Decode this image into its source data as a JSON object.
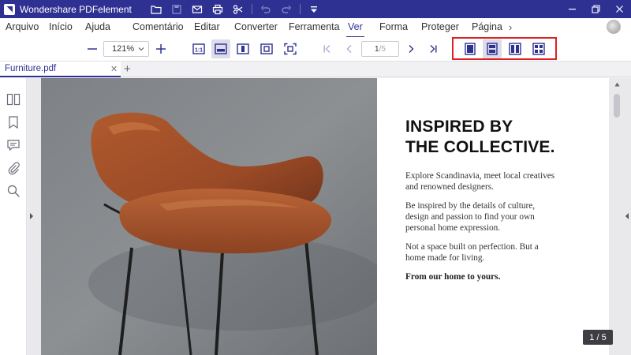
{
  "app": {
    "title": "Wondershare PDFelement"
  },
  "menu": {
    "items": [
      {
        "label": "Arquivo"
      },
      {
        "label": "Início"
      },
      {
        "label": "Ajuda"
      },
      {
        "label": "Comentário"
      },
      {
        "label": "Editar"
      },
      {
        "label": "Converter"
      },
      {
        "label": "Ferramenta"
      },
      {
        "label": "Ver",
        "active": true
      },
      {
        "label": "Forma"
      },
      {
        "label": "Proteger"
      },
      {
        "label": "Página"
      }
    ],
    "more_icon": "chevron-right-icon"
  },
  "toolbar": {
    "zoom_value": "121%",
    "page_current": "1",
    "page_total": "/5",
    "highlighted_group": [
      "single-page-view",
      "single-page-scroll-view",
      "two-page-view",
      "two-page-scroll-view"
    ]
  },
  "tabs": [
    {
      "label": "Furniture.pdf"
    }
  ],
  "document": {
    "headline_line1": "INSPIRED BY",
    "headline_line2": "THE COLLECTIVE.",
    "para1": "Explore Scandinavia, meet local creatives\nand renowned designers.",
    "para2": "Be inspired by the details of culture,\ndesign and passion to find your own\npersonal home expression.",
    "para3": "Not a space built on perfection. But a\nhome made for living.",
    "para4": "From our home to yours."
  },
  "page_indicator": "1 / 5",
  "colors": {
    "brand": "#2e3192",
    "highlight": "#e02020",
    "chair_leather": "#9a4a26"
  }
}
